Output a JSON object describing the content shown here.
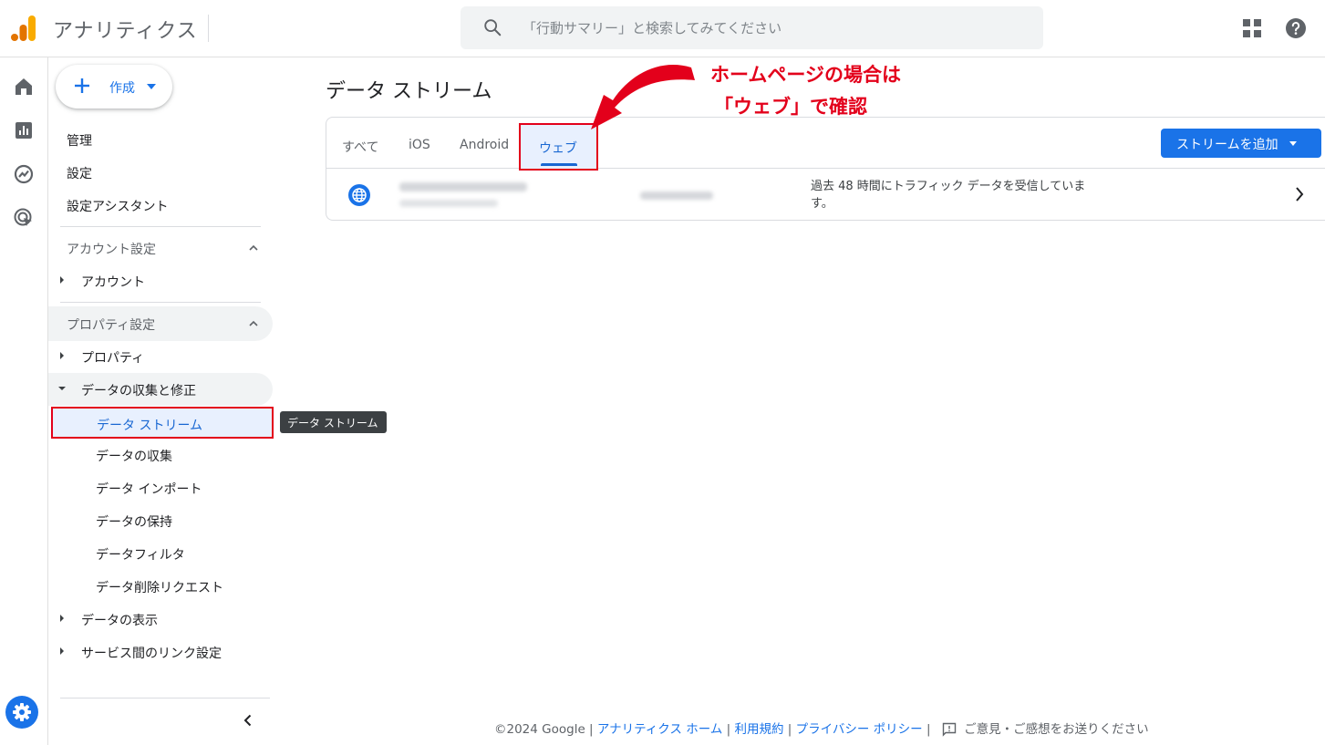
{
  "header": {
    "app_title": "アナリティクス",
    "search_placeholder": "「行動サマリー」と検索してみてください"
  },
  "nav": {
    "create_label": "作成",
    "items": [
      "管理",
      "設定",
      "設定アシスタント"
    ],
    "account_section": "アカウント設定",
    "account_item": "アカウント",
    "property_section": "プロパティ設定",
    "property_item": "プロパティ",
    "collect_item": "データの収集と修正",
    "sub_items": [
      "データ ストリーム",
      "データの収集",
      "データ インポート",
      "データの保持",
      "データフィルタ",
      "データ削除リクエスト"
    ],
    "display_item": "データの表示",
    "link_item": "サービス間のリンク設定",
    "tooltip": "データ ストリーム"
  },
  "main": {
    "page_title": "データ ストリーム",
    "tabs": [
      "すべて",
      "iOS",
      "Android",
      "ウェブ"
    ],
    "active_tab": "ウェブ",
    "add_stream_label": "ストリームを追加",
    "stream_status": "過去 48 時間にトラフィック データを受信しています。"
  },
  "annotation": {
    "line1": "ホームページの場合は",
    "line2": "「ウェブ」で確認",
    "color": "#e3001b"
  },
  "footer": {
    "copyright": "©2024 Google |",
    "home_link": "アナリティクス ホーム",
    "sep1": "|",
    "terms_link": "利用規約",
    "sep2": "|",
    "privacy_link": "プライバシー ポリシー",
    "sep3": "|",
    "feedback": "ご意見・ご感想をお送りください"
  },
  "colors": {
    "primary": "#1a73e8",
    "selected_bg": "#e8f0fe",
    "highlight_border": "#e3001b"
  }
}
